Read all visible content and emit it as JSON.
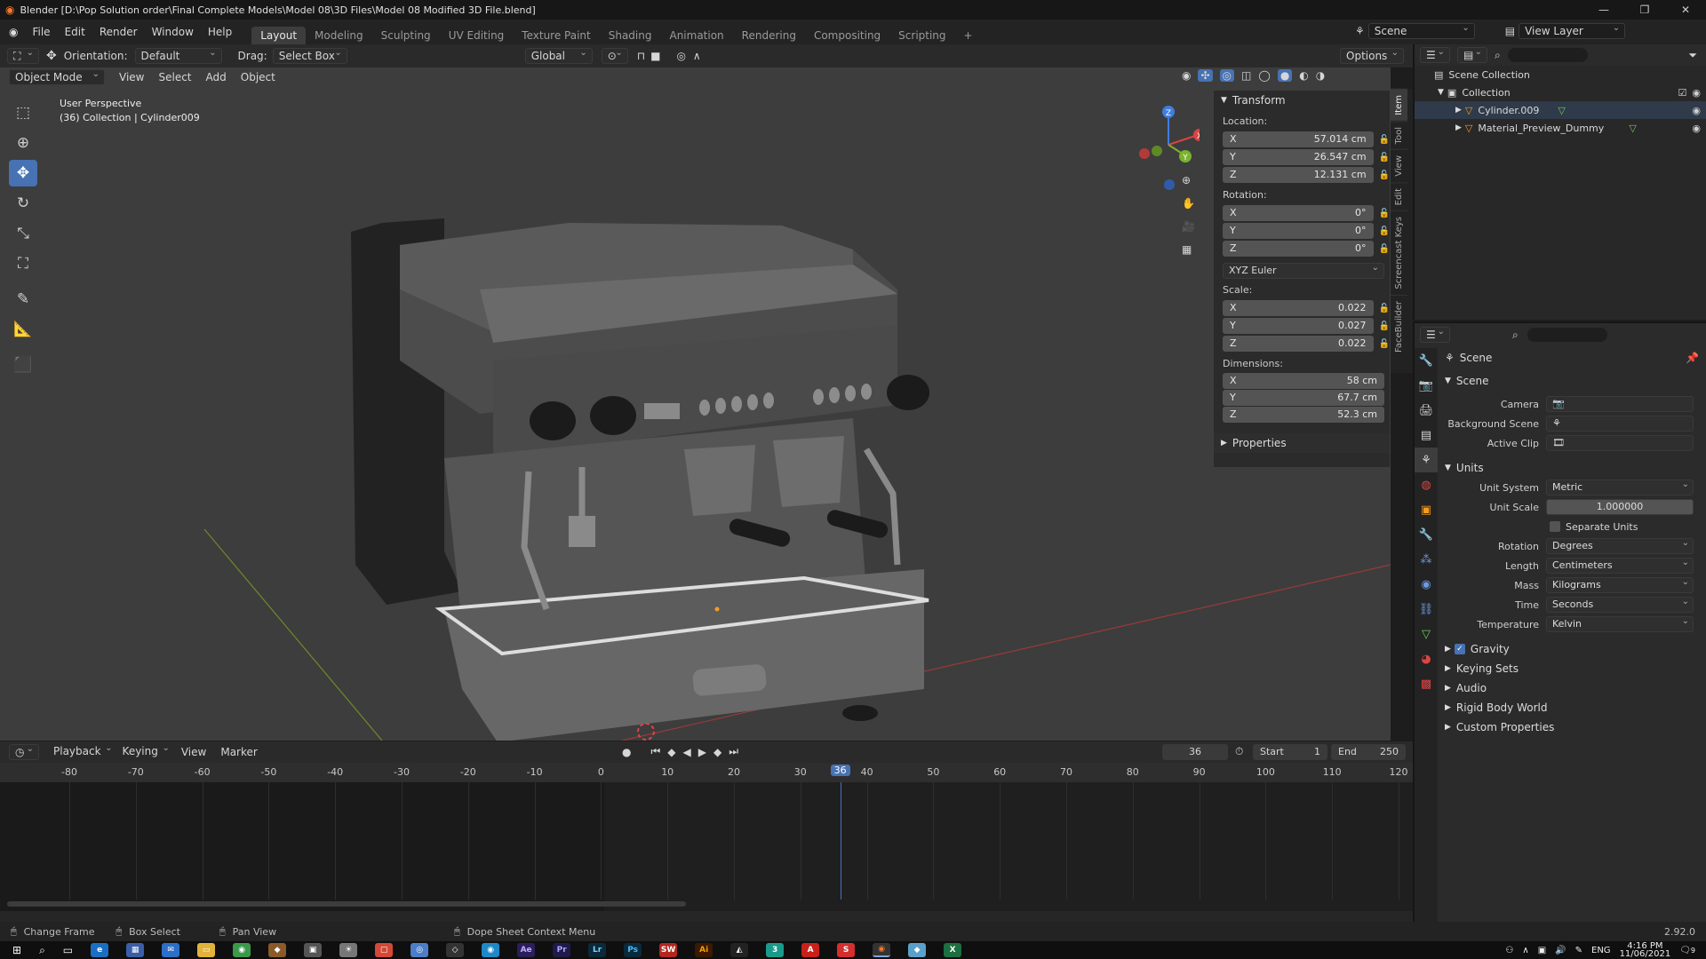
{
  "titlebar": {
    "title": "Blender [D:\\Pop Solution order\\Final Complete Models\\Model 08\\3D Files\\Model 08 Modified 3D File.blend]",
    "min": "—",
    "max": "❐",
    "close": "✕"
  },
  "menu": [
    "File",
    "Edit",
    "Render",
    "Window",
    "Help"
  ],
  "workspaces": [
    "Layout",
    "Modeling",
    "Sculpting",
    "UV Editing",
    "Texture Paint",
    "Shading",
    "Animation",
    "Rendering",
    "Compositing",
    "Scripting"
  ],
  "active_workspace": "Layout",
  "scene_selector": {
    "scene": "Scene",
    "view_layer": "View Layer"
  },
  "toolheader": {
    "orientation_label": "Orientation:",
    "orientation_value": "Default",
    "drag_label": "Drag:",
    "drag_value": "Select Box",
    "transform_orientation": "Global",
    "options": "Options"
  },
  "viewport_header": {
    "mode": "Object Mode",
    "menus": [
      "View",
      "Select",
      "Add",
      "Object"
    ]
  },
  "viewport": {
    "perspective": "User Perspective",
    "collection_info": "(36) Collection | Cylinder009",
    "gizmo_axes": [
      "X",
      "Y",
      "Z"
    ]
  },
  "npanel": {
    "transform_title": "Transform",
    "location_label": "Location:",
    "location": [
      {
        "axis": "X",
        "value": "57.014 cm"
      },
      {
        "axis": "Y",
        "value": "26.547 cm"
      },
      {
        "axis": "Z",
        "value": "12.131 cm"
      }
    ],
    "rotation_label": "Rotation:",
    "rotation": [
      {
        "axis": "X",
        "value": "0°"
      },
      {
        "axis": "Y",
        "value": "0°"
      },
      {
        "axis": "Z",
        "value": "0°"
      }
    ],
    "rotation_mode": "XYZ Euler",
    "scale_label": "Scale:",
    "scale": [
      {
        "axis": "X",
        "value": "0.022"
      },
      {
        "axis": "Y",
        "value": "0.027"
      },
      {
        "axis": "Z",
        "value": "0.022"
      }
    ],
    "dimensions_label": "Dimensions:",
    "dimensions": [
      {
        "axis": "X",
        "value": "58 cm"
      },
      {
        "axis": "Y",
        "value": "67.7 cm"
      },
      {
        "axis": "Z",
        "value": "52.3 cm"
      }
    ],
    "properties_title": "Properties",
    "tabs": [
      "Item",
      "Tool",
      "View",
      "Edit",
      "Screencast Keys",
      "FaceBuilder"
    ]
  },
  "outliner": {
    "scene_collection": "Scene Collection",
    "collection": "Collection",
    "items": [
      "Cylinder.009",
      "Material_Preview_Dummy"
    ]
  },
  "properties": {
    "context": "Scene",
    "scene_section": "Scene",
    "camera_label": "Camera",
    "bg_scene_label": "Background Scene",
    "active_clip_label": "Active Clip",
    "units_section": "Units",
    "unit_system_label": "Unit System",
    "unit_system": "Metric",
    "unit_scale_label": "Unit Scale",
    "unit_scale": "1.000000",
    "separate_units": "Separate Units",
    "rotation_label": "Rotation",
    "rotation": "Degrees",
    "length_label": "Length",
    "length": "Centimeters",
    "mass_label": "Mass",
    "mass": "Kilograms",
    "time_label": "Time",
    "time": "Seconds",
    "temperature_label": "Temperature",
    "temperature": "Kelvin",
    "gravity": "Gravity",
    "collapsed": [
      "Keying Sets",
      "Audio",
      "Rigid Body World",
      "Custom Properties"
    ]
  },
  "timeline": {
    "menus": [
      "Playback",
      "Keying",
      "View",
      "Marker"
    ],
    "current_frame": "36",
    "start_label": "Start",
    "start": "1",
    "end_label": "End",
    "end": "250",
    "ruler": [
      "-80",
      "-70",
      "-60",
      "-50",
      "-40",
      "-30",
      "-20",
      "-10",
      "0",
      "10",
      "20",
      "30",
      "40",
      "50",
      "60",
      "70",
      "80",
      "90",
      "100",
      "110",
      "120"
    ],
    "playhead": "36"
  },
  "statusbar": {
    "items": [
      "Change Frame",
      "Box Select",
      "Pan View",
      "Dope Sheet Context Menu"
    ],
    "version": "2.92.0"
  },
  "taskbar": {
    "apps": [
      "Ae",
      "Pr",
      "Lr",
      "Ps",
      "SW",
      "Ai"
    ],
    "lang": "ENG",
    "time": "4:16 PM",
    "date": "11/06/2021",
    "notifications": "9"
  }
}
